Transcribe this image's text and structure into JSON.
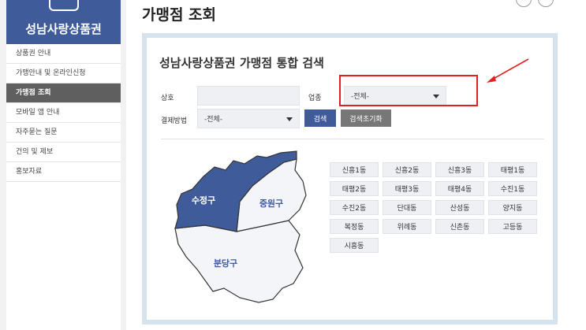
{
  "sidebar": {
    "brand": "성남사랑상품권",
    "items": [
      {
        "label": "상품권 안내",
        "active": false
      },
      {
        "label": "가맹안내 및 온라인신청",
        "active": false
      },
      {
        "label": "가맹점 조회",
        "active": true
      },
      {
        "label": "모바일 앱 안내",
        "active": false
      },
      {
        "label": "자주묻는 질문",
        "active": false
      },
      {
        "label": "건의 및 제보",
        "active": false
      },
      {
        "label": "홍보자료",
        "active": false
      }
    ]
  },
  "page": {
    "title": "가맹점 조회"
  },
  "search": {
    "title": "성남사랑상품권 가맹점 통합 검색",
    "name_label": "상호",
    "name_value": "",
    "category_label": "업종",
    "category_selected": "-전체-",
    "payment_label": "결제방법",
    "payment_selected": "-전체-",
    "search_button": "검색",
    "reset_button": "검색초기화"
  },
  "map": {
    "districts": [
      {
        "name": "수정구",
        "color": "#3f5b9a",
        "label_color": "#ffffff"
      },
      {
        "name": "중원구",
        "color": "#f4f5f9",
        "label_color": "#3f5b9a"
      },
      {
        "name": "분당구",
        "color": "#f4f5f9",
        "label_color": "#3f5b9a"
      }
    ]
  },
  "dongs": [
    "신흥1동",
    "신흥2동",
    "신흥3동",
    "태평1동",
    "태평2동",
    "태평3동",
    "태평4동",
    "수진1동",
    "수진2동",
    "단대동",
    "산성동",
    "양지동",
    "복정동",
    "위례동",
    "신촌동",
    "고등동",
    "시흥동"
  ],
  "colors": {
    "brand": "#3f5b9a",
    "highlight": "#e12020",
    "panel_border": "#d6e2ec"
  }
}
